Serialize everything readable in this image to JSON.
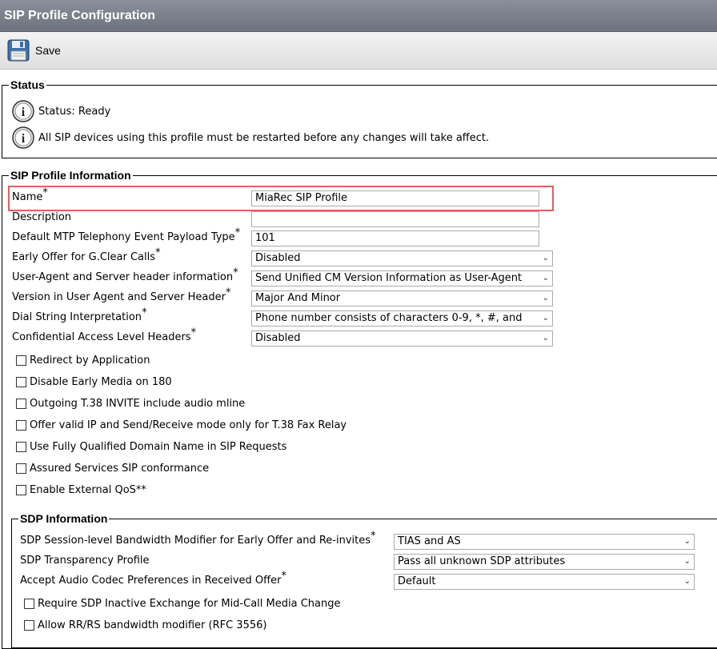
{
  "header": {
    "title": "SIP Profile Configuration"
  },
  "toolbar": {
    "save_label": "Save"
  },
  "status": {
    "legend": "Status",
    "messages": [
      "Status: Ready",
      "All SIP devices using this profile must be restarted before any changes will take affect."
    ]
  },
  "sip_profile_info": {
    "legend": "SIP Profile Information",
    "name": {
      "label": "Name",
      "required": "*",
      "value": "MiaRec SIP Profile"
    },
    "description": {
      "label": "Description",
      "value": ""
    },
    "mtp_payload": {
      "label": "Default MTP Telephony Event Payload Type",
      "required": "*",
      "value": "101"
    },
    "early_offer": {
      "label": "Early Offer for G.Clear Calls",
      "required": "*",
      "value": "Disabled"
    },
    "user_agent": {
      "label": "User-Agent and Server header information",
      "required": "*",
      "value": "Send Unified CM Version Information as User-Agent"
    },
    "version": {
      "label": "Version in User Agent and Server Header",
      "required": "*",
      "value": "Major And Minor"
    },
    "dial_string": {
      "label": "Dial String Interpretation",
      "required": "*",
      "value": "Phone number consists of characters 0-9, *, #, and"
    },
    "confidential": {
      "label": "Confidential Access Level Headers",
      "required": "*",
      "value": "Disabled"
    },
    "checkboxes": [
      "Redirect by Application",
      "Disable Early Media on 180",
      "Outgoing T.38 INVITE include audio mline",
      "Offer valid IP and Send/Receive mode only for T.38 Fax Relay",
      "Use Fully Qualified Domain Name in SIP Requests",
      "Assured Services SIP conformance",
      "Enable External QoS"
    ],
    "qos_marker": "**"
  },
  "sdp_info": {
    "legend": "SDP Information",
    "bandwidth": {
      "label": "SDP Session-level Bandwidth Modifier for Early Offer and Re-invites",
      "required": "*",
      "value": "TIAS and AS"
    },
    "transparency": {
      "label": "SDP Transparency Profile",
      "value": "Pass all unknown SDP attributes"
    },
    "codec_pref": {
      "label": "Accept Audio Codec Preferences in Received Offer",
      "required": "*",
      "value": "Default"
    },
    "checkboxes": [
      "Require SDP Inactive Exchange for Mid-Call Media Change",
      "Allow RR/RS bandwidth modifier (RFC 3556)"
    ]
  },
  "icons": {
    "save": "floppy-disk-icon",
    "info": "info-circle-icon"
  },
  "colors": {
    "title_bg": "#7a808a",
    "highlight": "#e06060"
  }
}
